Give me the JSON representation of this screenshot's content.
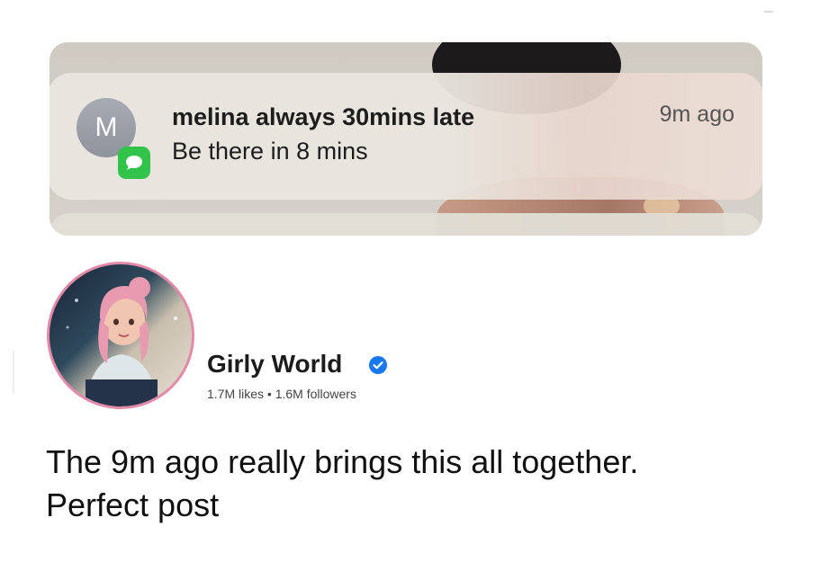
{
  "notification": {
    "avatar_initial": "M",
    "sender": "melina always 30mins late",
    "message": "Be there in 8 mins",
    "time": "9m ago",
    "app_icon": "messages-icon"
  },
  "page": {
    "name": "Girly World",
    "verified_icon": "verified-badge-icon",
    "stats": "1.7M likes • 1.6M followers"
  },
  "post": {
    "line1": "The 9m ago really brings this all together.",
    "line2": "Perfect post"
  },
  "colors": {
    "messages_green": "#31c34a",
    "verified_blue": "#1877f2",
    "profile_ring": "#e48aa9"
  }
}
